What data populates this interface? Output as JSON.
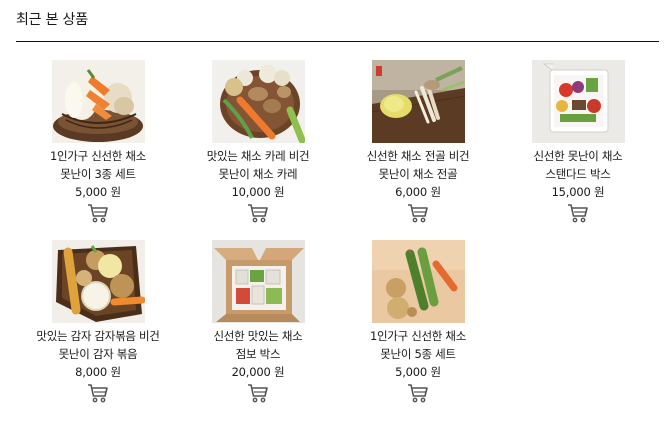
{
  "section": {
    "title": "최근 본 상품"
  },
  "products": [
    {
      "name_line1": "1인가구 신선한 채소",
      "name_line2": "못난이 3종 세트",
      "price": "5,000 원",
      "image": "veg-basket-radish-carrot"
    },
    {
      "name_line1": "맛있는 채소 카레 비건",
      "name_line2": "못난이 채소 카레",
      "price": "10,000 원",
      "image": "veg-curry-carrot-potato-onion"
    },
    {
      "name_line1": "신선한 채소 전골 비건",
      "name_line2": "못난이 채소 전골",
      "price": "6,000 원",
      "image": "veg-hotpot-cabbage-mushroom"
    },
    {
      "name_line1": "신선한 못난이 채소",
      "name_line2": "스탠다드 박스",
      "price": "15,000 원",
      "image": "veg-standard-box"
    },
    {
      "name_line1": "맛있는 감자 감자볶음 비건",
      "name_line2": "못난이 감자 볶음",
      "price": "8,000 원",
      "image": "veg-potato-stirfry"
    },
    {
      "name_line1": "신선한 맛있는 채소",
      "name_line2": "점보 박스",
      "price": "20,000 원",
      "image": "veg-jumbo-box"
    },
    {
      "name_line1": "1인가구 신선한 채소",
      "name_line2": "못난이 5종 세트",
      "price": "5,000 원",
      "image": "veg-5-set"
    }
  ],
  "icons": {
    "cart": "shopping-cart-icon"
  },
  "colors": {
    "divider": "#111111",
    "cart_icon": "#555555"
  }
}
